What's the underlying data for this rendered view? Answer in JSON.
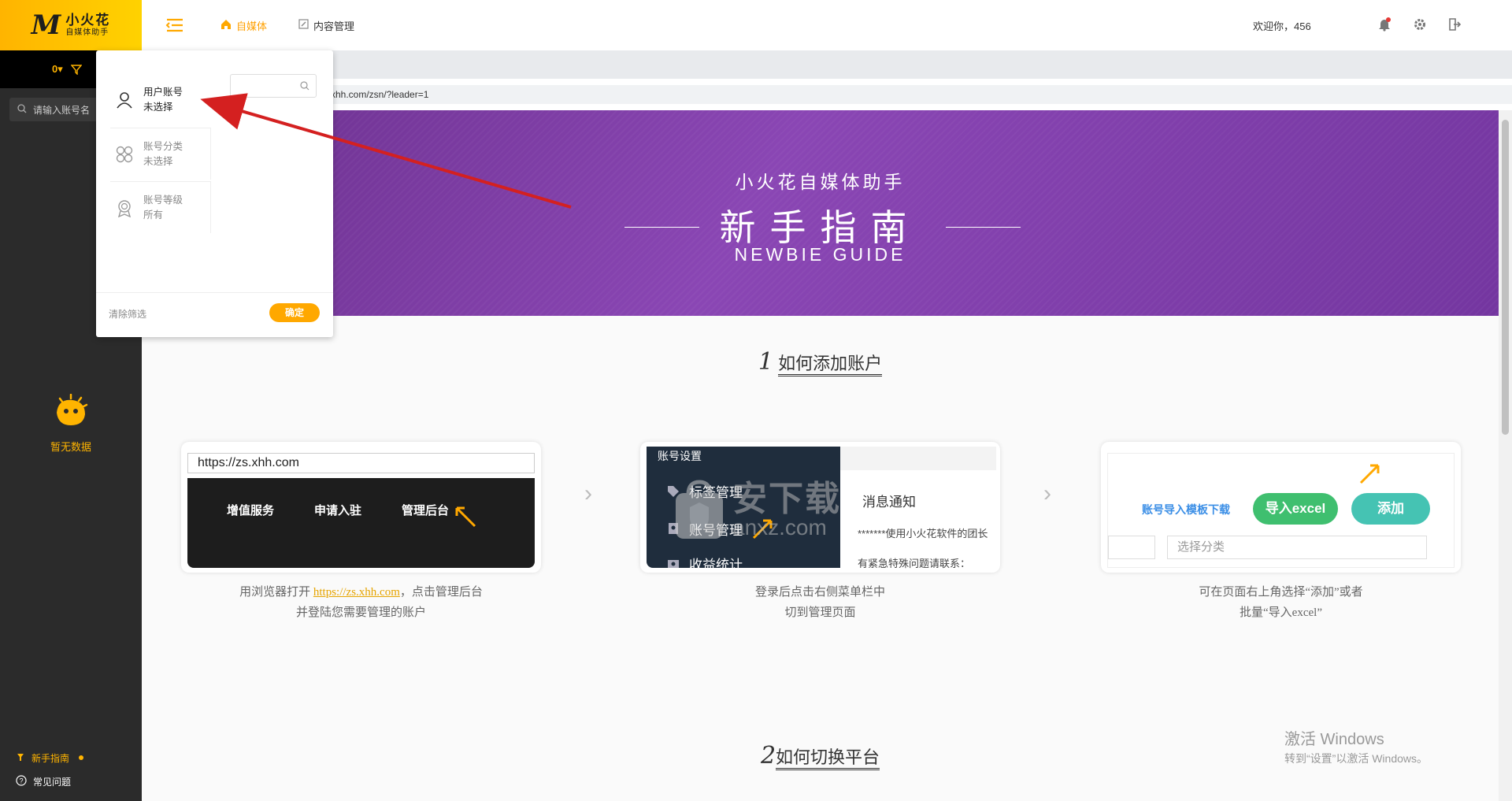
{
  "sidebar": {
    "logo_mark": "M",
    "logo_title": "小火花",
    "logo_subtitle": "自媒体助手",
    "account_count": "0",
    "search_placeholder": "请输入账号名",
    "empty_text": "暂无数据",
    "guide_label": "新手指南",
    "faq_label": "常见问题"
  },
  "topbar": {
    "nav": [
      {
        "label": "自媒体",
        "icon": "home-icon"
      },
      {
        "label": "内容管理",
        "icon": "edit-icon"
      }
    ],
    "welcome": "欢迎你，456"
  },
  "address_bar": {
    "url": "xhh.com/zsn/?leader=1"
  },
  "filter_panel": {
    "options": [
      {
        "title": "用户账号",
        "value": "未选择",
        "icon": "user-icon"
      },
      {
        "title": "账号分类",
        "value": "未选择",
        "icon": "category-icon"
      },
      {
        "title": "账号等级",
        "value": "所有",
        "icon": "badge-icon"
      }
    ],
    "clear_label": "清除筛选",
    "confirm_label": "确定"
  },
  "banner": {
    "subtitle": "小火花自媒体助手",
    "title": "新手指南",
    "english": "NEWBIE GUIDE"
  },
  "sections": [
    {
      "num": "1",
      "title": "如何添加账户"
    },
    {
      "num": "2",
      "title": "如何切换平台"
    }
  ],
  "steps": [
    {
      "url_text": "https://zs.xhh.com",
      "menu": [
        "增值服务",
        "申请入驻",
        "管理后台"
      ],
      "caption_pre": "用浏览器打开 ",
      "caption_link": "https://zs.xhh.com",
      "caption_post": "，点击管理后台",
      "caption_line2": "并登陆您需要管理的账户"
    },
    {
      "header": "账号设置",
      "menu": [
        "标签管理",
        "账号管理",
        "收益统计"
      ],
      "notice_title": "消息通知",
      "notice_line1": "*******使用小火花软件的团长",
      "notice_line2": "有紧急特殊问题请联系：",
      "caption_line1": "登录后点击右侧菜单栏中",
      "caption_line2": "切到管理页面"
    },
    {
      "template_link": "账号导入模板下载",
      "import_btn": "导入excel",
      "add_btn": "添加",
      "select_placeholder": "选择分类",
      "caption_line1": "可在页面右上角选择“添加”或者",
      "caption_line2": "批量“导入excel”"
    }
  ],
  "watermark": {
    "cn": "安下载",
    "en": "anxz.com"
  },
  "windows_activation": {
    "line1": "激活 Windows",
    "line2": "转到“设置”以激活 Windows。"
  },
  "colors": {
    "accent": "#ffa800",
    "banner": "#7d3aa6",
    "sidebar": "#2b2b2b",
    "arrow": "#d42020"
  }
}
